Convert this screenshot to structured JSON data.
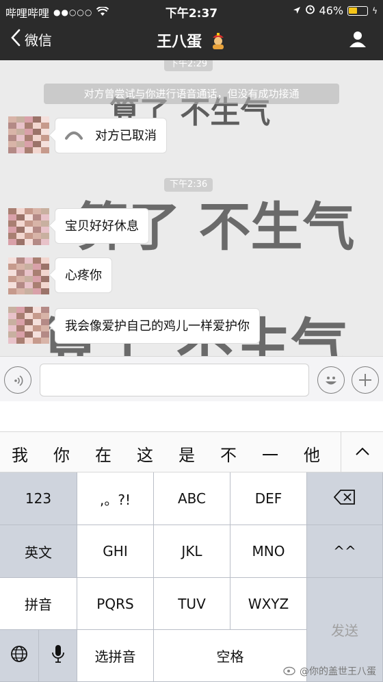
{
  "status_bar": {
    "carrier": "哔哩哔哩",
    "time": "下午2:37",
    "battery_percent": "46%",
    "battery_level": 0.46
  },
  "nav": {
    "back_label": "微信",
    "title": "王八蛋"
  },
  "chat": {
    "watermark_text": "算了 不生气",
    "timestamps": [
      "下午2:29",
      "下午2:36"
    ],
    "system_message": "对方曾尝试与你进行语音通话，但没有成功接通",
    "messages": [
      {
        "type": "call",
        "text": "对方已取消"
      },
      {
        "type": "text",
        "text": "宝贝好好休息"
      },
      {
        "type": "text",
        "text": "心疼你"
      },
      {
        "type": "text",
        "text": "我会像爱护自己的鸡儿一样爱护你"
      }
    ]
  },
  "keyboard": {
    "candidates": [
      "我",
      "你",
      "在",
      "这",
      "是",
      "不",
      "一",
      "他"
    ],
    "keys": {
      "num": "123",
      "punct": ",。?!",
      "abc": "ABC",
      "def": "DEF",
      "ghi": "GHI",
      "jkl": "JKL",
      "mno": "MNO",
      "emoticon": "^^",
      "english": "英文",
      "pinyin": "拼音",
      "pqrs": "PQRS",
      "tuv": "TUV",
      "wxyz": "WXYZ",
      "select_pinyin": "选拼音",
      "space": "空格",
      "send": "发送"
    }
  },
  "caption": "@你的盖世王八蛋",
  "colors": {
    "bar_bg": "#2b2b2b",
    "chat_bg": "#ebebeb",
    "battery": "#f5c518",
    "keyboard_bg": "#cfd4dd"
  }
}
